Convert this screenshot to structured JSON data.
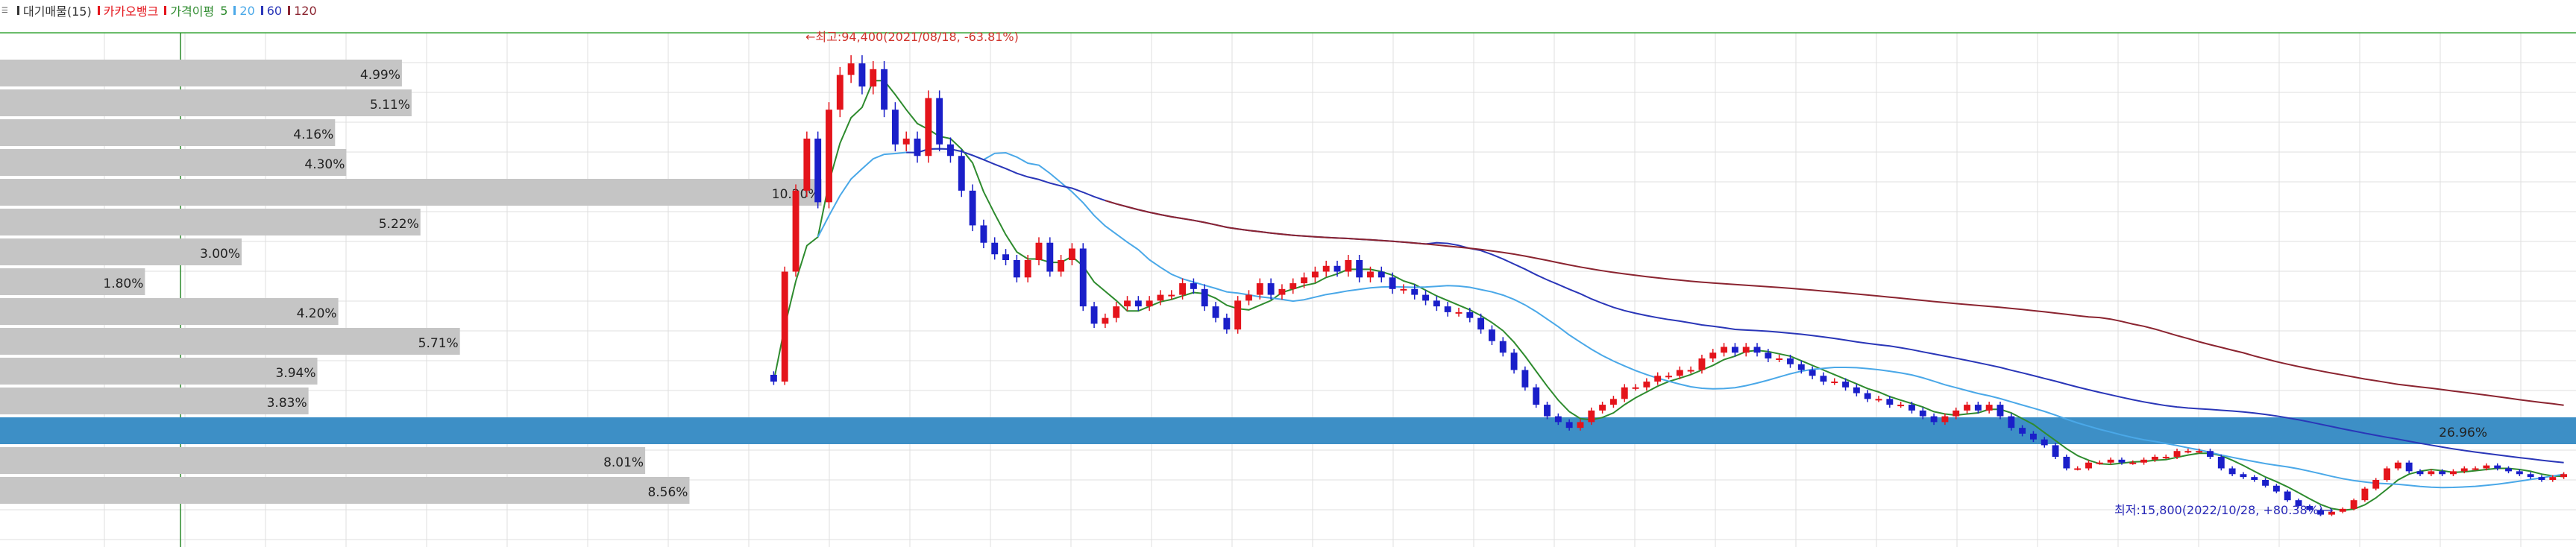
{
  "legend": {
    "volume_profile": "대기매물(15)",
    "stock_name": "카카오뱅크",
    "ma_label": "가격이평",
    "ma_periods": [
      "5",
      "20",
      "60",
      "120"
    ]
  },
  "colors": {
    "grid": "#dfdfdf",
    "profile_bar": "#c5c5c5",
    "profile_highlight": "#3d8fc6",
    "up_candle": "#e4141b",
    "down_candle": "#1a1fc9",
    "ma5": "#2e8b2e",
    "ma20": "#4aa8e8",
    "ma60": "#2a36b8",
    "ma120": "#8b2430",
    "high_line": "#3aa63a",
    "cursor_line": "#2a8a2a",
    "high_annotation": "#d0342c",
    "low_annotation": "#2a2ab8"
  },
  "chart_data": [
    {
      "type": "bar",
      "orientation": "horizontal",
      "title": "대기매물(15)",
      "values": [
        4.99,
        5.11,
        4.16,
        4.3,
        10.2,
        5.22,
        3.0,
        1.8,
        4.2,
        5.71,
        3.94,
        3.83,
        26.96,
        8.01,
        8.56
      ],
      "labels": [
        "4.99%",
        "5.11%",
        "4.16%",
        "4.30%",
        "10.20%",
        "5.22%",
        "3.00%",
        "1.80%",
        "4.20%",
        "5.71%",
        "3.94%",
        "3.83%",
        "26.96%",
        "8.01%",
        "8.56%"
      ],
      "highlight_index": 12
    },
    {
      "type": "candlestick",
      "title": "카카오뱅크",
      "series": [
        {
          "name": "5"
        },
        {
          "name": "20"
        },
        {
          "name": "60"
        },
        {
          "name": "120"
        }
      ],
      "y_scale": {
        "min": 13500,
        "max": 98000
      },
      "candles_close": [
        39000,
        58000,
        72000,
        81000,
        70000,
        86000,
        92000,
        94000,
        90000,
        93000,
        86000,
        80000,
        81000,
        78000,
        88000,
        80000,
        78000,
        72000,
        66000,
        63000,
        61000,
        60000,
        57000,
        60000,
        63000,
        58000,
        60000,
        62000,
        52000,
        49000,
        50000,
        52000,
        53000,
        52000,
        53000,
        54000,
        54000,
        56000,
        55000,
        52000,
        50000,
        48000,
        53000,
        54000,
        56000,
        54000,
        55000,
        56000,
        57000,
        58000,
        59000,
        58000,
        60000,
        57000,
        58000,
        57000,
        55000,
        55000,
        54000,
        53000,
        52000,
        51000,
        51000,
        50000,
        48000,
        46000,
        44000,
        41000,
        38000,
        35000,
        33000,
        32000,
        31000,
        32000,
        34000,
        35000,
        36000,
        38000,
        38000,
        39000,
        40000,
        40000,
        41000,
        41000,
        43000,
        44000,
        45000,
        44000,
        45000,
        44000,
        43000,
        43000,
        42000,
        41000,
        40000,
        39000,
        39000,
        38000,
        37000,
        36000,
        36000,
        35000,
        35000,
        34000,
        33000,
        32000,
        33000,
        34000,
        35000,
        34000,
        35000,
        33000,
        31000,
        30000,
        29000,
        28000,
        26000,
        24000,
        24000,
        25000,
        25000,
        25500,
        25000,
        25000,
        25500,
        26000,
        26000,
        27000,
        27000,
        27000,
        26000,
        24000,
        23000,
        22500,
        22000,
        21000,
        20000,
        18500,
        17500,
        16800,
        16000,
        16500,
        17000,
        18500,
        20500,
        22000,
        24000,
        25000,
        23500,
        23000,
        23500,
        23000,
        23500,
        24000,
        24000,
        24500,
        24000,
        23500,
        23000,
        22500,
        22000,
        22500,
        23000
      ]
    }
  ],
  "annotations": {
    "high": "←최고:94,400(2021/08/18, -63.81%)",
    "low": "최저:15,800(2022/10/28, +80.38%)→"
  }
}
